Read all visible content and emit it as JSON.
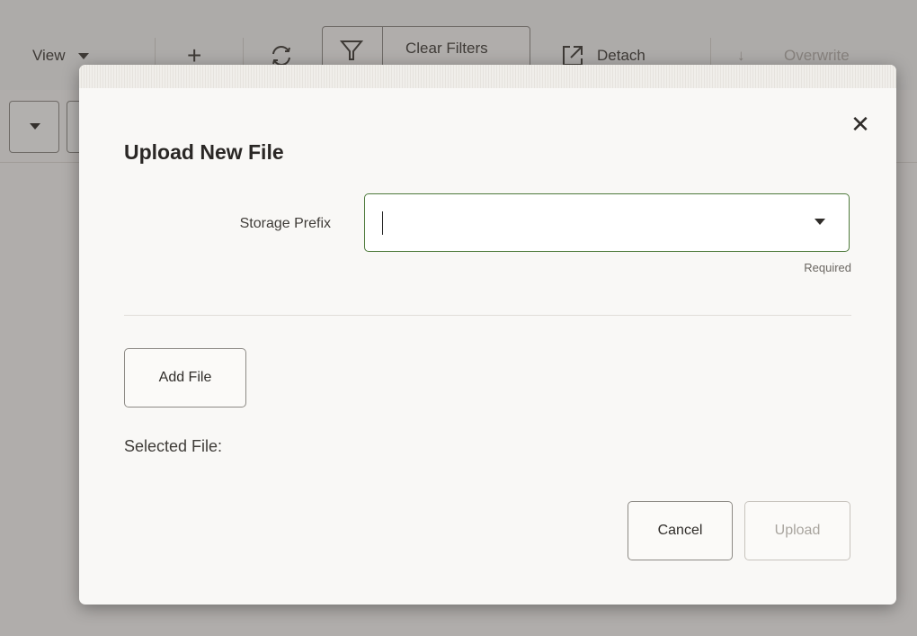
{
  "toolbar": {
    "view_label": "View",
    "add_icon": "plus-icon",
    "refresh_icon": "refresh-icon",
    "filter_icon": "funnel-icon",
    "clear_filters_label": "Clear Filters",
    "detach_label": "Detach",
    "detach_icon": "detach-icon",
    "download_icon": "download-icon",
    "overwrite_label": "Overwrite"
  },
  "dialog": {
    "title": "Upload New File",
    "close_icon": "close-icon",
    "storage_prefix_label": "Storage Prefix",
    "storage_prefix_value": "",
    "required_hint": "Required",
    "add_file_label": "Add File",
    "selected_file_label": "Selected File:",
    "cancel_label": "Cancel",
    "upload_label": "Upload"
  },
  "colors": {
    "input_border_focus": "#4e7a3b",
    "dialog_bg": "#f9f8f6",
    "disabled_text": "#a9a59f"
  }
}
